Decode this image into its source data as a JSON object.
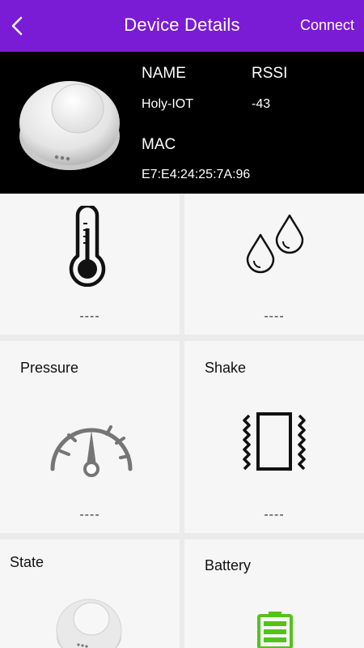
{
  "appbar": {
    "title": "Device Details",
    "action": "Connect",
    "background": "#7a1bd6"
  },
  "device": {
    "name_label": "NAME",
    "name_value": "Holy-IOT",
    "rssi_label": "RSSI",
    "rssi_value": "-43",
    "mac_label": "MAC",
    "mac_value": "E7:E4:24:25:7A:96"
  },
  "cards": {
    "temperature": {
      "icon": "thermometer-icon",
      "value": "----"
    },
    "humidity": {
      "icon": "water-drops-icon",
      "value": "----"
    },
    "pressure": {
      "title": "Pressure",
      "icon": "gauge-icon",
      "value": "----"
    },
    "shake": {
      "title": "Shake",
      "icon": "vibration-icon",
      "value": "----"
    },
    "state": {
      "title": "State",
      "icon": "device-icon"
    },
    "battery": {
      "title": "Battery",
      "icon": "battery-icon",
      "color": "#55c21b"
    }
  }
}
